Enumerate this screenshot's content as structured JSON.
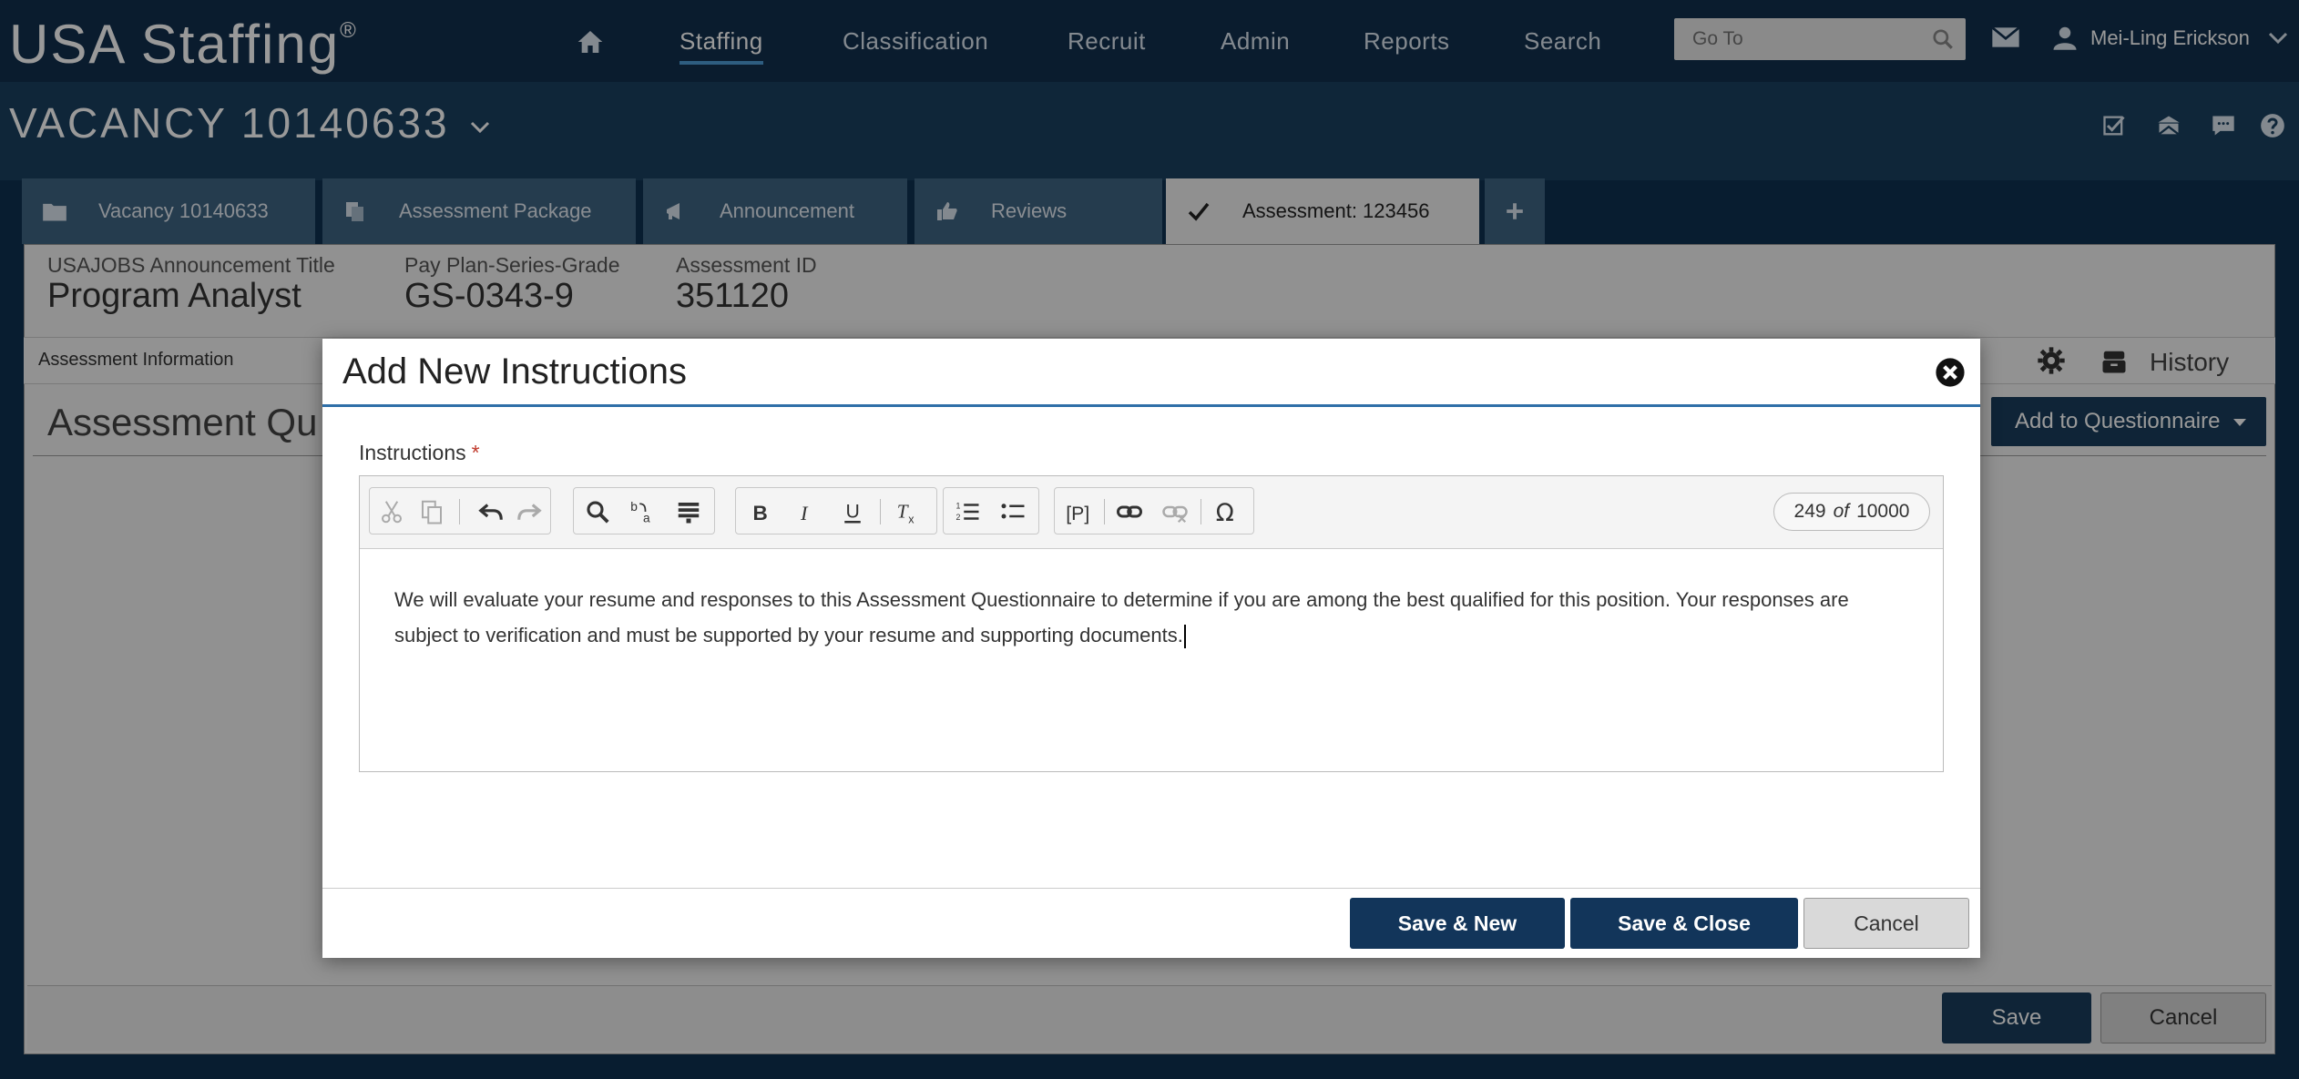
{
  "header": {
    "brand": "USA Staffing",
    "brand_mark": "®",
    "nav": [
      "Staffing",
      "Classification",
      "Recruit",
      "Admin",
      "Reports",
      "Search"
    ],
    "goto_placeholder": "Go To",
    "user_name": "Mei-Ling Erickson"
  },
  "vacancy": {
    "title": "VACANCY 10140633"
  },
  "tabs": [
    {
      "label": "Vacancy 10140633",
      "icon": "folder-icon"
    },
    {
      "label": "Assessment Package",
      "icon": "copy-icon"
    },
    {
      "label": "Announcement",
      "icon": "megaphone-icon"
    },
    {
      "label": "Reviews",
      "icon": "thumbs-up-icon"
    },
    {
      "label": "Assessment: 123456",
      "icon": "check-icon"
    }
  ],
  "page": {
    "announcement_label": "USAJOBS Announcement Title",
    "announcement_value": "Program Analyst",
    "grade_label": "Pay Plan-Series-Grade",
    "grade_value": "GS-0343-9",
    "assessment_label": "Assessment ID",
    "assessment_value": "351120",
    "subnav_first": "Assessment Information",
    "history": "History",
    "section_title": "Assessment Qu",
    "add_to_questionnaire": "Add to Questionnaire",
    "save": "Save",
    "cancel": "Cancel"
  },
  "modal": {
    "title": "Add New Instructions",
    "field_label": "Instructions",
    "required_mark": "*",
    "counter_current": "249",
    "counter_of": "of",
    "counter_max": "10000",
    "body_text": "We will evaluate your resume and responses to this Assessment Questionnaire to determine if you are among the best qualified for this position. Your responses are subject to verification and must be supported by your resume and supporting documents.",
    "save_new": "Save & New",
    "save_close": "Save & Close",
    "cancel": "Cancel"
  },
  "colors": {
    "header_bg": "#112f4d",
    "vacancy_bg": "#1a4060",
    "tab_bg": "#3f6482",
    "primary_button": "#12355a",
    "modal_rule": "#2f6fa8"
  }
}
